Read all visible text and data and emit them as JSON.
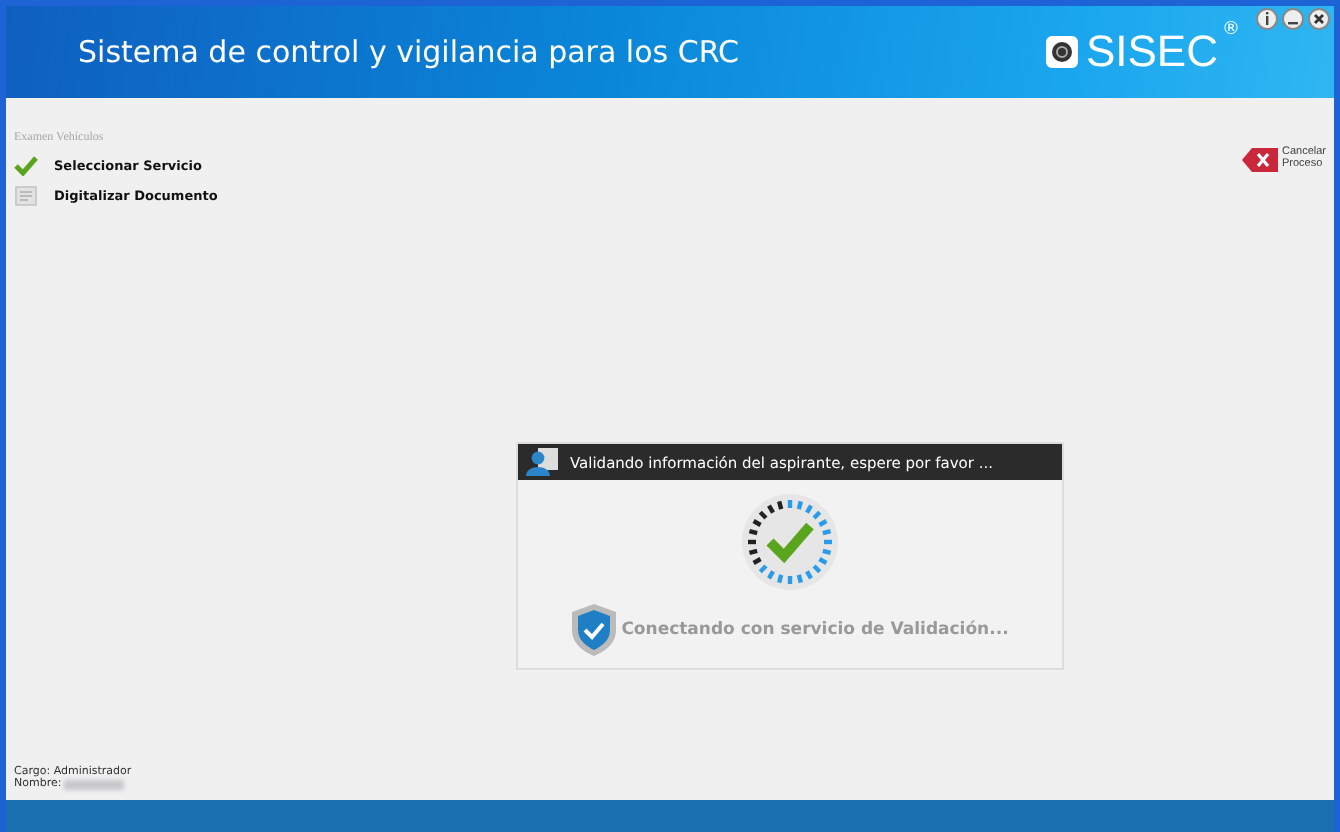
{
  "header": {
    "title": "Sistema de control y vigilancia para los CRC",
    "logo": "SISEC",
    "logo_mark": "®"
  },
  "process": {
    "title": "Examen Vehículos",
    "steps": [
      {
        "label": "Seleccionar Servicio",
        "done": true
      },
      {
        "label": "Digitalizar Documento",
        "done": false
      }
    ]
  },
  "cancel_button": {
    "label_lines": [
      "Cancelar",
      "Proceso"
    ]
  },
  "dialog": {
    "title": "Validando información del aspirante, espere por favor ...",
    "status": "Conectando con servicio de Validación..."
  },
  "user": {
    "role": "Cargo: Administrador",
    "name_label": "Nombre:"
  }
}
